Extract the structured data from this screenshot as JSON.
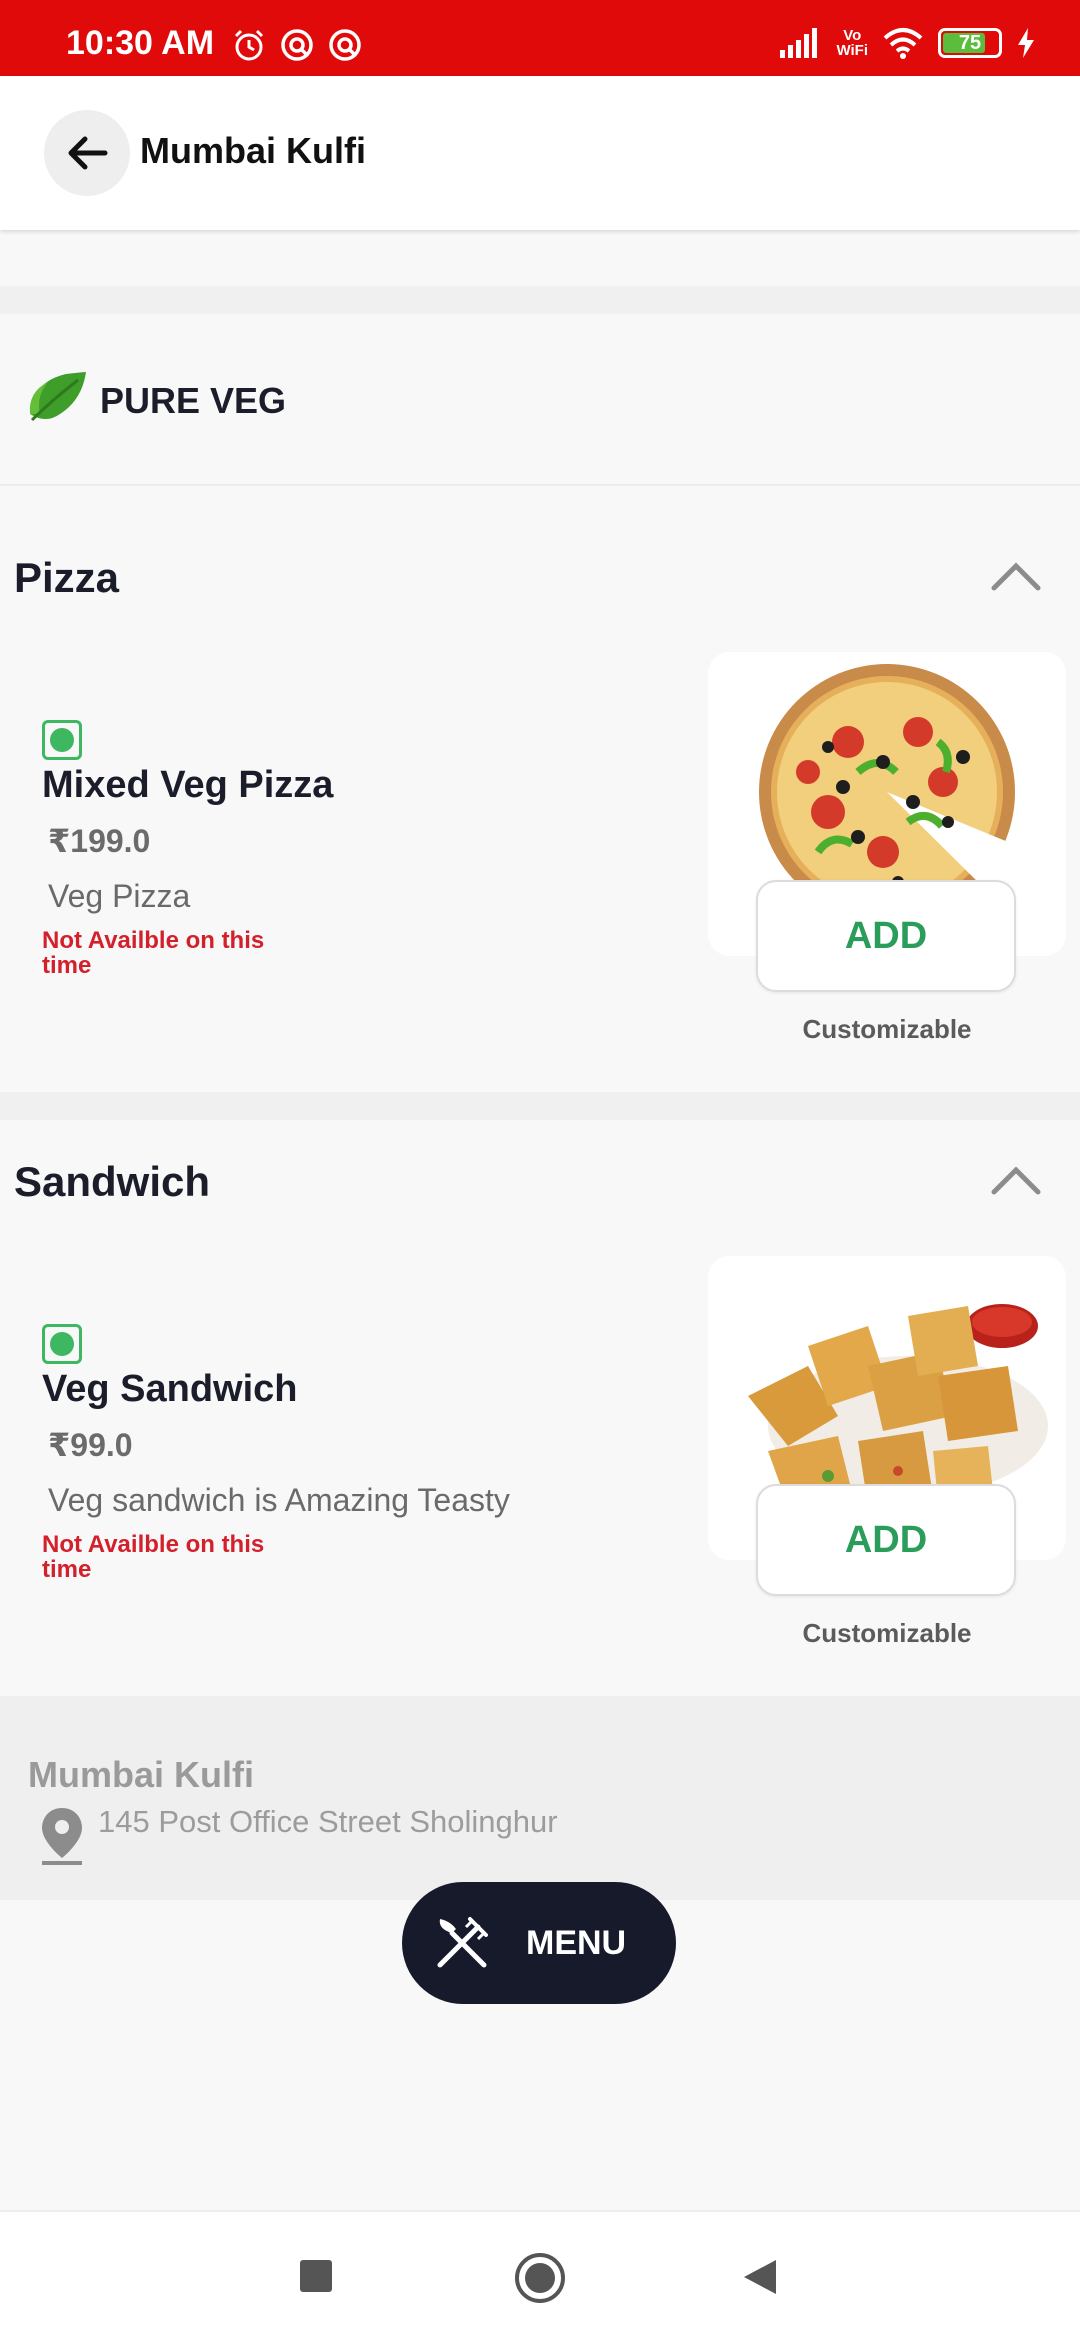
{
  "status_bar": {
    "time": "10:30 AM",
    "vowifi_top": "Vo",
    "vowifi_bottom": "WiFi",
    "battery_level": "75",
    "background_color": "#e00a0a"
  },
  "header": {
    "title": "Mumbai Kulfi",
    "back_icon": "arrow-left-icon"
  },
  "veg_badge": {
    "label": "PURE VEG",
    "icon": "leaf-icon"
  },
  "categories": [
    {
      "title": "Pizza",
      "expanded": true,
      "items": [
        {
          "name": "Mixed Veg Pizza",
          "price": "₹199.0",
          "description": "Veg Pizza",
          "availability": "Not Availble on this time",
          "add_label": "ADD",
          "customizable_label": "Customizable",
          "veg": true
        }
      ]
    },
    {
      "title": "Sandwich",
      "expanded": true,
      "items": [
        {
          "name": "Veg Sandwich",
          "price": "₹99.0",
          "description": "Veg sandwich is Amazing Teasty",
          "availability": "Not Availble on this time",
          "add_label": "ADD",
          "customizable_label": "Customizable",
          "veg": true
        }
      ]
    }
  ],
  "restaurant_info": {
    "name": "Mumbai Kulfi",
    "address": "145 Post Office Street Sholinghur",
    "icon": "location-pin-icon"
  },
  "menu_button": {
    "label": "MENU",
    "icon": "fork-knife-icon"
  },
  "colors": {
    "accent_green": "#2a9d5b",
    "veg_green": "#3db760",
    "unavailable_red": "#d3212c",
    "dark_navy": "#161a2b"
  }
}
